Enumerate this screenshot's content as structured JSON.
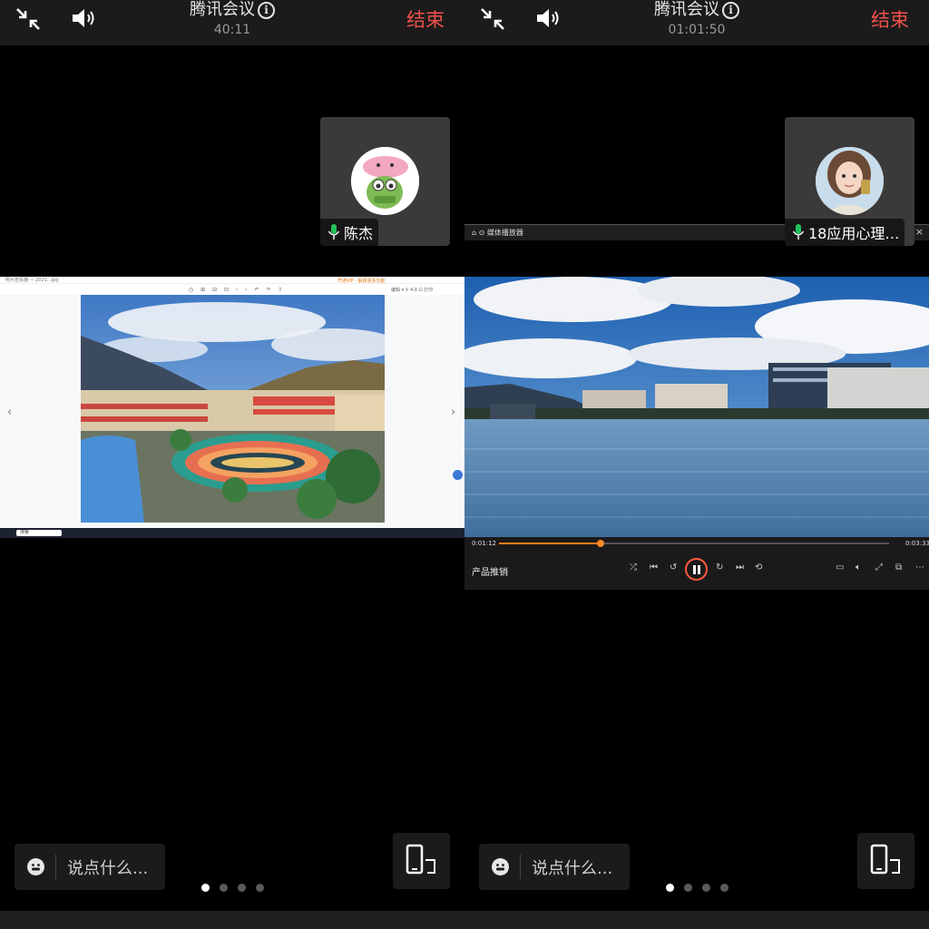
{
  "left": {
    "header": {
      "title": "腾讯会议",
      "timer": "40:11",
      "end_label": "结束"
    },
    "participant": {
      "name": "陈杰"
    },
    "chat": {
      "placeholder": "说点什么..."
    },
    "photo_viewer": {
      "titlebar_text": "照片查看器 — 2021...jpg",
      "vip_text": "开通VIP · 解锁更多功能",
      "toolbar_text": "◷ ⊞ ⊟ ⊡ ‹ › ↶ ↷ ⇧",
      "right_text": "编辑 ▾   ⚲ 4.0   ⊡ 打印",
      "search_text": "搜索"
    },
    "pagination": {
      "count": 4,
      "active": 0
    }
  },
  "right": {
    "header": {
      "title": "腾讯会议",
      "timer": "01:01:50",
      "end_label": "结束"
    },
    "participant": {
      "name": "18应用心理…"
    },
    "chat": {
      "placeholder": "说点什么..."
    },
    "player": {
      "app_title": "媒体播放器",
      "elapsed": "0:01:12",
      "total": "0:03:33",
      "progress": 0.26,
      "track_name": "产品推销",
      "accent": "#ff7a1a"
    },
    "pagination": {
      "count": 4,
      "active": 0
    }
  },
  "icons": {
    "shrink": "shrink-arrows-icon",
    "speaker": "speaker-icon",
    "info": "info-icon",
    "mic": "mic-icon",
    "emoji": "emoji-icon",
    "rotate": "rotate-phone-icon"
  },
  "colors": {
    "end": "#f0514a",
    "mic": "#22c25a",
    "tile": "#3a3a3a"
  }
}
